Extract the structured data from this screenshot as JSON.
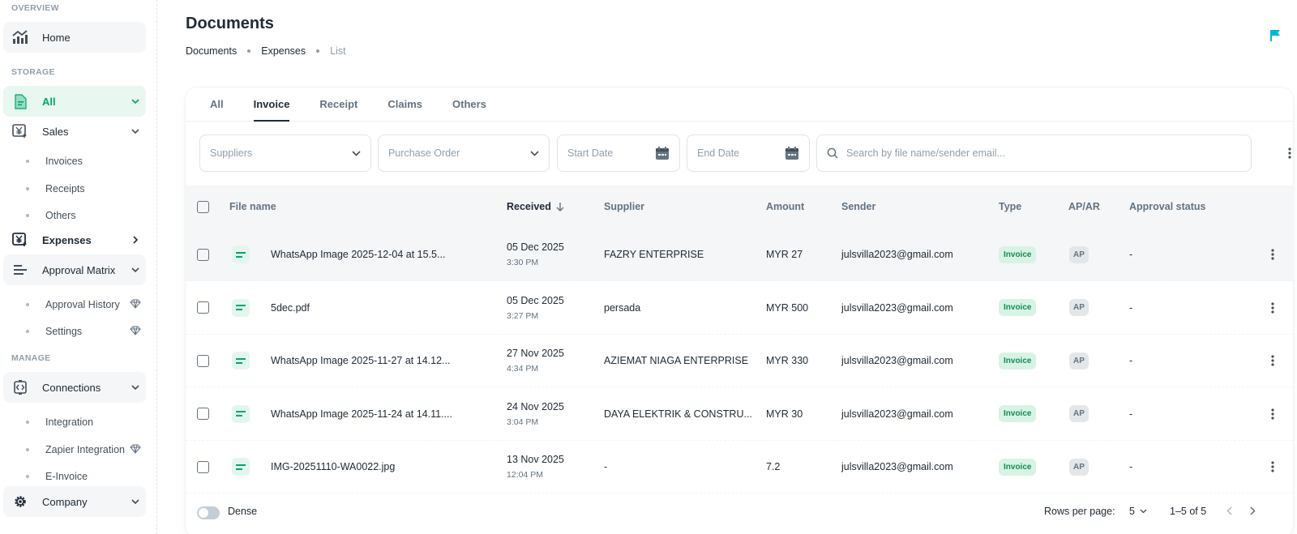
{
  "sidebar": {
    "overview_label": "OVERVIEW",
    "home": "Home",
    "storage_label": "STORAGE",
    "all": "All",
    "sales": "Sales",
    "sales_sub": [
      "Invoices",
      "Receipts",
      "Others"
    ],
    "expenses": "Expenses",
    "approval_matrix": "Approval Matrix",
    "approval_sub": [
      "Approval History",
      "Settings"
    ],
    "manage_label": "MANAGE",
    "connections": "Connections",
    "connections_sub": [
      "Integration",
      "Zapier Integration",
      "E-Invoice"
    ],
    "company": "Company"
  },
  "page": {
    "title": "Documents",
    "breadcrumb": [
      "Documents",
      "Expenses",
      "List"
    ]
  },
  "tabs": [
    "All",
    "Invoice",
    "Receipt",
    "Claims",
    "Others"
  ],
  "active_tab": "Invoice",
  "filters": {
    "suppliers": "Suppliers",
    "purchase_order": "Purchase Order",
    "start_date": "Start Date",
    "end_date": "End Date",
    "search_placeholder": "Search by file name/sender email..."
  },
  "table": {
    "headers": [
      "File name",
      "Received",
      "Supplier",
      "Amount",
      "Sender",
      "Type",
      "AP/AR",
      "Approval status"
    ],
    "rows": [
      {
        "file": "WhatsApp Image 2025-12-04 at 15.5...",
        "date": "05 Dec 2025",
        "time": "3:30 PM",
        "supplier": "FAZRY ENTERPRISE",
        "amount": "MYR 27",
        "sender": "julsvilla2023@gmail.com",
        "type": "Invoice",
        "apar": "AP",
        "status": "-"
      },
      {
        "file": "5dec.pdf",
        "date": "05 Dec 2025",
        "time": "3:27 PM",
        "supplier": "persada",
        "amount": "MYR 500",
        "sender": "julsvilla2023@gmail.com",
        "type": "Invoice",
        "apar": "AP",
        "status": "-"
      },
      {
        "file": "WhatsApp Image 2025-11-27 at 14.12...",
        "date": "27 Nov 2025",
        "time": "4:34 PM",
        "supplier": "AZIEMAT NIAGA ENTERPRISE",
        "amount": "MYR 330",
        "sender": "julsvilla2023@gmail.com",
        "type": "Invoice",
        "apar": "AP",
        "status": "-"
      },
      {
        "file": "WhatsApp Image 2025-11-24 at 14.11....",
        "date": "24 Nov 2025",
        "time": "3:04 PM",
        "supplier": "DAYA ELEKTRIK & CONSTRU...",
        "amount": "MYR 30",
        "sender": "julsvilla2023@gmail.com",
        "type": "Invoice",
        "apar": "AP",
        "status": "-"
      },
      {
        "file": "IMG-20251110-WA0022.jpg",
        "date": "13 Nov 2025",
        "time": "12:04 PM",
        "supplier": "-",
        "amount": "7.2",
        "sender": "julsvilla2023@gmail.com",
        "type": "Invoice",
        "apar": "AP",
        "status": "-"
      }
    ]
  },
  "footer": {
    "dense": "Dense",
    "rows_per_page_label": "Rows per page:",
    "rows_per_page": "5",
    "range": "1–5 of 5"
  },
  "colors": {
    "accent": "#00a76f",
    "flag": "#00b8d9"
  }
}
